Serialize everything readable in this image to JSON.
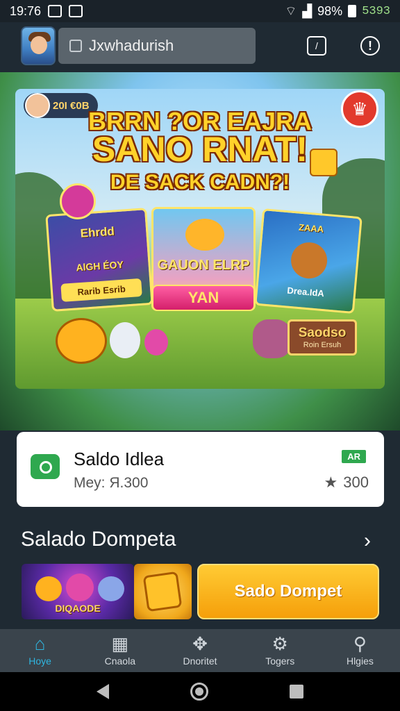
{
  "status_bar": {
    "time": "19:76",
    "battery_percent": "98%",
    "extra": "5393"
  },
  "header": {
    "search_text": "Jxwhadurish"
  },
  "banner": {
    "coin_count": "20I €0B",
    "headline_line1": "BRRN ?OR EAJRA",
    "headline_line2": "SANO RNAT!",
    "headline_line3": "DE SACK CADN?!",
    "card_left_title": "Ehrdd",
    "card_left_sub": "AlGH ÉOY",
    "card_left_pill": "Rarib Esrib",
    "card_center_title": "GAUON ELRP",
    "card_center_button": "YAN",
    "card_right_title": "ZAAA",
    "card_right_pill": "Drea.IdA",
    "sign_title": "Saodso",
    "sign_sub": "Roin Ersuh"
  },
  "balance": {
    "title": "Saldo Idlea",
    "subtitle": "Mey: Я.300",
    "tag": "AR",
    "rating": "300"
  },
  "section": {
    "title": "Salado Dompeta"
  },
  "promo": {
    "thumb_label": "DIQAODE",
    "button_label": "Sado Dompet"
  },
  "bottom_nav": {
    "items": [
      {
        "label": "Hoye",
        "icon": "home-icon"
      },
      {
        "label": "Cnaola",
        "icon": "grid-icon"
      },
      {
        "label": "Dnoritet",
        "icon": "puzzle-icon"
      },
      {
        "label": "Togers",
        "icon": "gear-icon"
      },
      {
        "label": "Hlgies",
        "icon": "user-icon"
      }
    ],
    "active_color": "#2fb6e0"
  }
}
